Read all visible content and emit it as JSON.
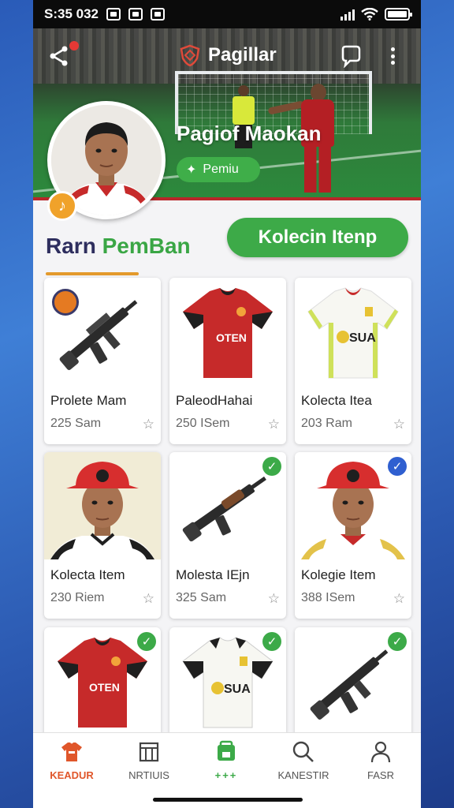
{
  "status_bar": {
    "time": "S:35 032"
  },
  "header": {
    "title": "Pagillar"
  },
  "profile": {
    "name": "Pagiof Maokan",
    "badge_label": "Pemiu",
    "music_badge": "♪"
  },
  "section": {
    "title_part1": "Rarn ",
    "title_part2": "PemBan",
    "collection_button": "Kolecin Itenp"
  },
  "items": [
    {
      "name": "Prolete Mam",
      "price": "225 Sam",
      "image": "rifle-icon",
      "check": ""
    },
    {
      "name": "PaleodHahai",
      "price": "250 ISem",
      "image": "red-jersey-icon",
      "check": ""
    },
    {
      "name": "Kolecta Itea",
      "price": "203 Ram",
      "image": "white-jersey-icon",
      "check": ""
    },
    {
      "name": "Kolecta Item",
      "price": "230 Riem",
      "image": "player-portrait",
      "check": ""
    },
    {
      "name": "Molesta IEjn",
      "price": "325 Sam",
      "image": "rifle-icon",
      "check": "green"
    },
    {
      "name": "Kolegie Item",
      "price": "388 ISem",
      "image": "player-portrait",
      "check": "blue"
    },
    {
      "name": "",
      "price": "",
      "image": "red-jersey-icon",
      "check": "green"
    },
    {
      "name": "",
      "price": "",
      "image": "white-black-jersey-icon",
      "check": "green"
    },
    {
      "name": "",
      "price": "",
      "image": "rifle-icon",
      "check": "green"
    }
  ],
  "nav": [
    {
      "label": "KEADUR",
      "icon": "jersey-icon"
    },
    {
      "label": "NRTIUIS",
      "icon": "grid-icon"
    },
    {
      "label": "+++",
      "icon": "collection-icon"
    },
    {
      "label": "KANESTIR",
      "icon": "search-icon"
    },
    {
      "label": "FASR",
      "icon": "profile-icon"
    }
  ],
  "colors": {
    "accent_green": "#3daa48",
    "accent_orange": "#e39a2c",
    "jersey_red": "#c62a2a",
    "title_navy": "#2e2e5e"
  }
}
